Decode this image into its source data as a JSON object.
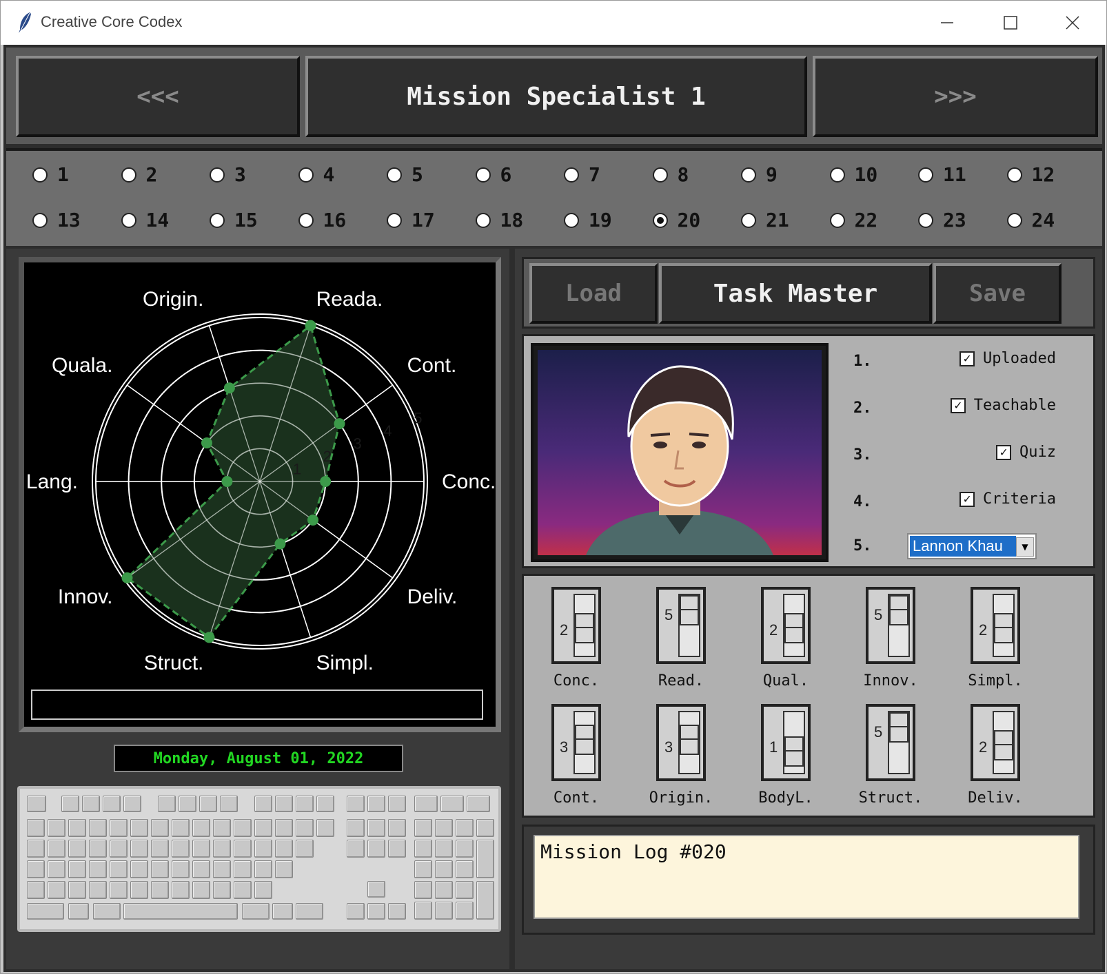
{
  "window": {
    "title": "Creative Core Codex"
  },
  "header": {
    "prev_label": "<<<",
    "title": "Mission Specialist 1",
    "next_label": ">>>"
  },
  "radios": {
    "selected": "20",
    "row1": [
      "1",
      "2",
      "3",
      "4",
      "5",
      "6",
      "7",
      "8",
      "9",
      "10",
      "11",
      "12"
    ],
    "row2": [
      "13",
      "14",
      "15",
      "16",
      "17",
      "18",
      "19",
      "20",
      "21",
      "22",
      "23",
      "24"
    ]
  },
  "chart_data": {
    "type": "radar",
    "axes": [
      "Conc.",
      "Cont.",
      "Reada.",
      "Origin.",
      "Quala.",
      "Lang.",
      "Innov.",
      "Struct.",
      "Simpl.",
      "Deliv."
    ],
    "values": [
      2,
      3,
      5,
      3,
      2,
      1,
      5,
      5,
      2,
      2
    ],
    "rmax": 5,
    "ring_labels": [
      "1",
      "2",
      "3",
      "4",
      "5"
    ],
    "colors": {
      "fill": "#1f3a22",
      "line": "#3c9a4a",
      "grid": "#ffffff",
      "bg": "#000000"
    }
  },
  "date_text": "Monday, August 01, 2022",
  "tabs": {
    "load": "Load",
    "task": "Task Master",
    "save": "Save"
  },
  "checklist": [
    {
      "num": "1.",
      "label": "Uploaded",
      "checked": true
    },
    {
      "num": "2.",
      "label": "Teachable",
      "checked": true
    },
    {
      "num": "3.",
      "label": "Quiz",
      "checked": true
    },
    {
      "num": "4.",
      "label": "Criteria",
      "checked": true
    }
  ],
  "name_select": {
    "num": "5.",
    "value": "Lannon Khau"
  },
  "sliders": [
    {
      "label": "Conc.",
      "value": "2",
      "level": 0.4
    },
    {
      "label": "Read.",
      "value": "5",
      "level": 1.0
    },
    {
      "label": "Qual.",
      "value": "2",
      "level": 0.4
    },
    {
      "label": "Innov.",
      "value": "5",
      "level": 1.0
    },
    {
      "label": "Simpl.",
      "value": "2",
      "level": 0.4
    },
    {
      "label": "Cont.",
      "value": "3",
      "level": 0.6
    },
    {
      "label": "Origin.",
      "value": "3",
      "level": 0.6
    },
    {
      "label": "BodyL.",
      "value": "1",
      "level": 0.2
    },
    {
      "label": "Struct.",
      "value": "5",
      "level": 1.0
    },
    {
      "label": "Deliv.",
      "value": "2",
      "level": 0.4
    }
  ],
  "log": {
    "text": "Mission Log #020"
  },
  "icons": {
    "app": "feather-icon",
    "min": "minimize-icon",
    "max": "maximize-icon",
    "close": "close-icon"
  }
}
